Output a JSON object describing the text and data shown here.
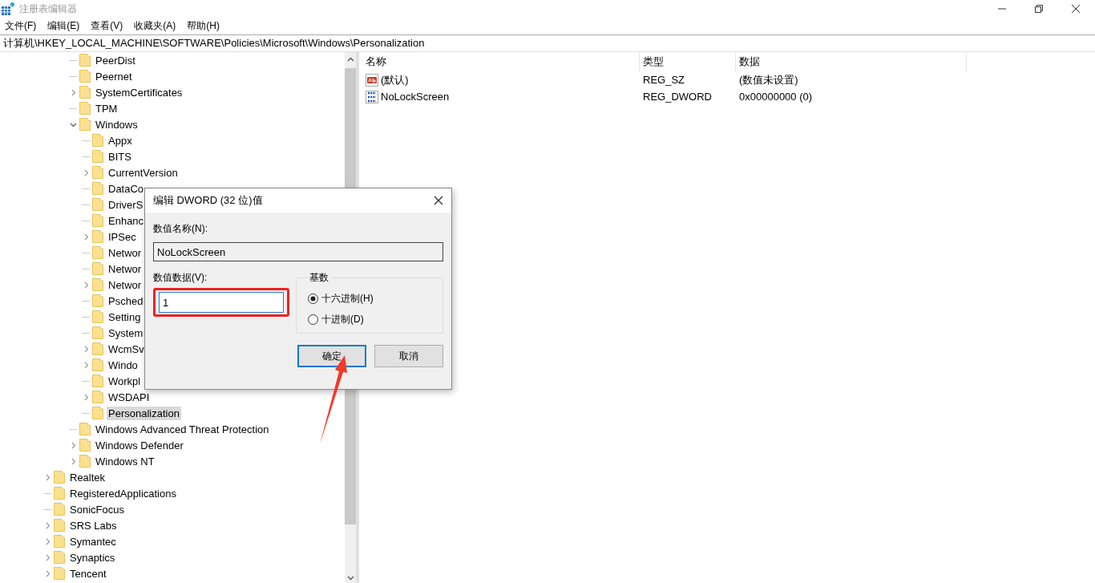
{
  "window": {
    "title": "注册表编辑器"
  },
  "menu": [
    "文件(F)",
    "编辑(E)",
    "查看(V)",
    "收藏夹(A)",
    "帮助(H)"
  ],
  "address": "计算机\\HKEY_LOCAL_MACHINE\\SOFTWARE\\Policies\\Microsoft\\Windows\\Personalization",
  "tree": [
    {
      "children": [
        {
          "children": [
            {
              "label": "PeerDist",
              "expandable": false,
              "expanded": false,
              "selected": false
            },
            {
              "label": "Peernet",
              "expandable": false,
              "expanded": false,
              "selected": false
            },
            {
              "label": "SystemCertificates",
              "expandable": true,
              "expanded": false,
              "selected": false
            },
            {
              "label": "TPM",
              "expandable": false,
              "expanded": false,
              "selected": false
            },
            {
              "label": "Windows",
              "expandable": true,
              "expanded": true,
              "selected": false,
              "children": [
                {
                  "label": "Appx",
                  "expandable": false,
                  "expanded": false,
                  "selected": false
                },
                {
                  "label": "BITS",
                  "expandable": false,
                  "expanded": false,
                  "selected": false
                },
                {
                  "label": "CurrentVersion",
                  "expandable": true,
                  "expanded": false,
                  "selected": false
                },
                {
                  "label": "DataCo",
                  "expandable": false,
                  "expanded": false,
                  "selected": false
                },
                {
                  "label": "DriverS",
                  "expandable": false,
                  "expanded": false,
                  "selected": false
                },
                {
                  "label": "Enhanc",
                  "expandable": false,
                  "expanded": false,
                  "selected": false
                },
                {
                  "label": "IPSec",
                  "expandable": true,
                  "expanded": false,
                  "selected": false
                },
                {
                  "label": "Networ",
                  "expandable": false,
                  "expanded": false,
                  "selected": false
                },
                {
                  "label": "Networ",
                  "expandable": false,
                  "expanded": false,
                  "selected": false
                },
                {
                  "label": "Networ",
                  "expandable": true,
                  "expanded": false,
                  "selected": false
                },
                {
                  "label": "Psched",
                  "expandable": false,
                  "expanded": false,
                  "selected": false
                },
                {
                  "label": "Setting",
                  "expandable": false,
                  "expanded": false,
                  "selected": false
                },
                {
                  "label": "System",
                  "expandable": false,
                  "expanded": false,
                  "selected": false
                },
                {
                  "label": "WcmSv",
                  "expandable": true,
                  "expanded": false,
                  "selected": false
                },
                {
                  "label": "Windo",
                  "expandable": true,
                  "expanded": false,
                  "selected": false
                },
                {
                  "label": "Workpl",
                  "expandable": false,
                  "expanded": false,
                  "selected": false
                },
                {
                  "label": "WSDAPI",
                  "expandable": true,
                  "expanded": false,
                  "selected": false
                },
                {
                  "label": "Personalization",
                  "expandable": false,
                  "expanded": false,
                  "selected": true
                }
              ]
            },
            {
              "label": "Windows Advanced Threat Protection",
              "expandable": false,
              "expanded": false,
              "selected": false
            },
            {
              "label": "Windows Defender",
              "expandable": true,
              "expanded": false,
              "selected": false
            },
            {
              "label": "Windows NT",
              "expandable": true,
              "expanded": false,
              "selected": false
            }
          ]
        }
      ]
    },
    {
      "label": "Realtek",
      "expandable": true,
      "expanded": false,
      "selected": false
    },
    {
      "label": "RegisteredApplications",
      "expandable": false,
      "expanded": false,
      "selected": false
    },
    {
      "label": "SonicFocus",
      "expandable": false,
      "expanded": false,
      "selected": false
    },
    {
      "label": "SRS Labs",
      "expandable": true,
      "expanded": false,
      "selected": false
    },
    {
      "label": "Symantec",
      "expandable": true,
      "expanded": false,
      "selected": false
    },
    {
      "label": "Synaptics",
      "expandable": true,
      "expanded": false,
      "selected": false
    },
    {
      "label": "Tencent",
      "expandable": true,
      "expanded": false,
      "selected": false
    }
  ],
  "values": {
    "columns": [
      "名称",
      "类型",
      "数据"
    ],
    "rows": [
      {
        "kind": "string",
        "name": "(默认)",
        "type": "REG_SZ",
        "data": "(数值未设置)"
      },
      {
        "kind": "dword",
        "name": "NoLockScreen",
        "type": "REG_DWORD",
        "data": "0x00000000 (0)"
      }
    ]
  },
  "dialog": {
    "title": "编辑 DWORD (32 位)值",
    "name_label": "数值名称(N):",
    "name_value": "NoLockScreen",
    "data_label": "数值数据(V):",
    "data_value": "1",
    "base_label": "基数",
    "base_options": [
      {
        "label": "十六进制(H)",
        "selected": true
      },
      {
        "label": "十进制(D)",
        "selected": false
      }
    ],
    "buttons": [
      {
        "label": "确定",
        "default": true
      },
      {
        "label": "取消",
        "default": false
      }
    ]
  }
}
